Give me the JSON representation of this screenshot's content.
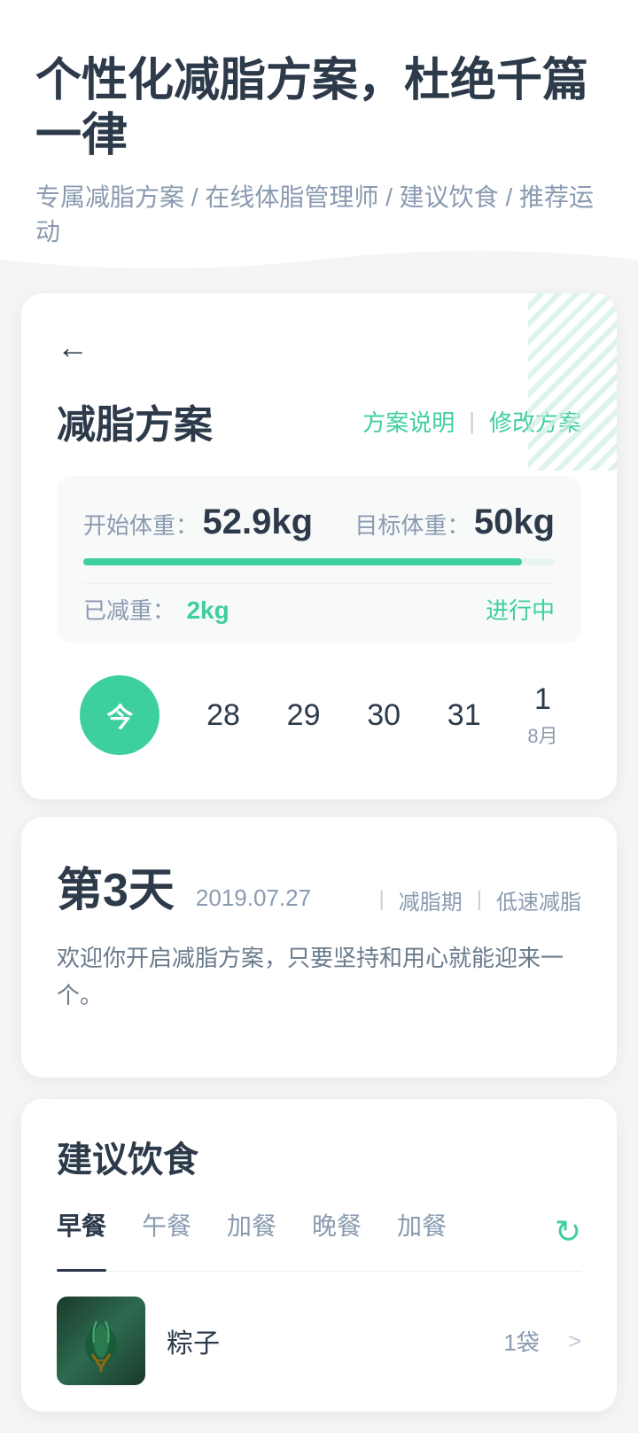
{
  "header": {
    "title": "个性化减脂方案，杜绝千篇一律",
    "subtitle": "专属减脂方案 / 在线体脂管理师 / 建议饮食 / 推荐运动"
  },
  "plan_card": {
    "back_icon": "←",
    "section_title": "减脂方案",
    "action_explain": "方案说明",
    "action_divider": "|",
    "action_modify": "修改方案",
    "weight_start_label": "开始体重：",
    "weight_start_value": "52.9kg",
    "weight_target_label": "目标体重：",
    "weight_target_value": "50kg",
    "progress_percent": 93,
    "lost_label": "已减重：",
    "lost_value": "2kg",
    "status": "进行中"
  },
  "calendar": {
    "today_label": "今",
    "days": [
      {
        "label": "28",
        "sub": ""
      },
      {
        "label": "29",
        "sub": ""
      },
      {
        "label": "30",
        "sub": ""
      },
      {
        "label": "31",
        "sub": ""
      },
      {
        "label": "1",
        "sub": "8月"
      }
    ]
  },
  "day_info": {
    "day_number": "第3天",
    "date": "2019.07.27",
    "sep1": "|",
    "tag1": "减脂期",
    "sep2": "|",
    "tag2": "低速减脂",
    "description": "欢迎你开启减脂方案，只要坚持和用心就能迎来一个。"
  },
  "diet": {
    "section_title": "建议饮食",
    "tabs": [
      {
        "label": "早餐",
        "active": true
      },
      {
        "label": "午餐",
        "active": false
      },
      {
        "label": "加餐",
        "active": false
      },
      {
        "label": "晚餐",
        "active": false
      },
      {
        "label": "加餐",
        "active": false
      }
    ],
    "refresh_icon": "↻",
    "food_item": {
      "name": "粽子",
      "qty": "1袋",
      "arrow": ">"
    }
  }
}
